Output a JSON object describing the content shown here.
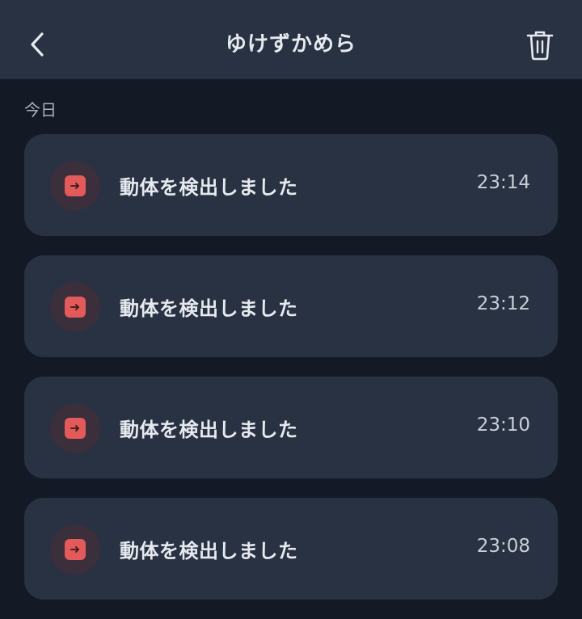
{
  "header": {
    "title": "ゆけずかめら",
    "back_icon": "chevron-left-icon",
    "trash_icon": "trash-icon"
  },
  "section": {
    "label": "今日"
  },
  "events": [
    {
      "text": "動体を検出しました",
      "time": "23:14",
      "icon": "motion-event-icon"
    },
    {
      "text": "動体を検出しました",
      "time": "23:12",
      "icon": "motion-event-icon"
    },
    {
      "text": "動体を検出しました",
      "time": "23:10",
      "icon": "motion-event-icon"
    },
    {
      "text": "動体を検出しました",
      "time": "23:08",
      "icon": "motion-event-icon"
    }
  ],
  "colors": {
    "background": "#141a25",
    "header": "#283242",
    "card": "#283242",
    "accent_red": "#e25a5a"
  }
}
